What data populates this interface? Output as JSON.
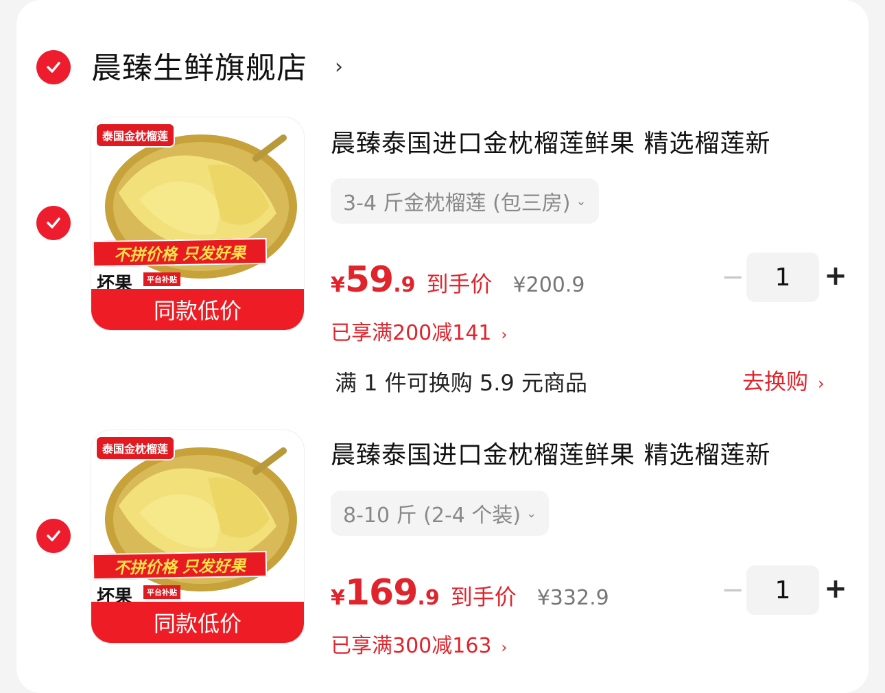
{
  "shop": {
    "name": "晨臻生鲜旗舰店",
    "chevron": "›"
  },
  "items": [
    {
      "image": {
        "tag": "泰国金枕榴莲",
        "slogan": "不拼价格 只发好果",
        "bad": "坏果",
        "sub": "平台补贴",
        "bottom": "同款低价"
      },
      "title": "晨臻泰国进口金枕榴莲鲜果 精选榴莲新",
      "spec": "3-4 斤金枕榴莲 (包三房)",
      "price": {
        "yen": "¥",
        "int": "59",
        "dec": ".9",
        "label": "到手价",
        "original": "¥200.9"
      },
      "promo": "已享满200减141",
      "qty": "1"
    },
    {
      "image": {
        "tag": "泰国金枕榴莲",
        "slogan": "不拼价格 只发好果",
        "bad": "坏果",
        "sub": "平台补贴",
        "bottom": "同款低价"
      },
      "title": "晨臻泰国进口金枕榴莲鲜果 精选榴莲新",
      "spec": "8-10 斤 (2-4 个装)",
      "price": {
        "yen": "¥",
        "int": "169",
        "dec": ".9",
        "label": "到手价",
        "original": "¥332.9"
      },
      "promo": "已享满300减163",
      "qty": "1"
    }
  ],
  "exchange": {
    "text": "满 1 件可换购 5.9 元商品",
    "link": "去换购"
  },
  "stepper": {
    "minus": "−",
    "plus": "+"
  },
  "icons": {
    "check": "check-icon",
    "chevron_right": "›",
    "chevron_down": "⌄"
  },
  "colors": {
    "accent": "#ee1d2e",
    "price": "#e0242c"
  }
}
